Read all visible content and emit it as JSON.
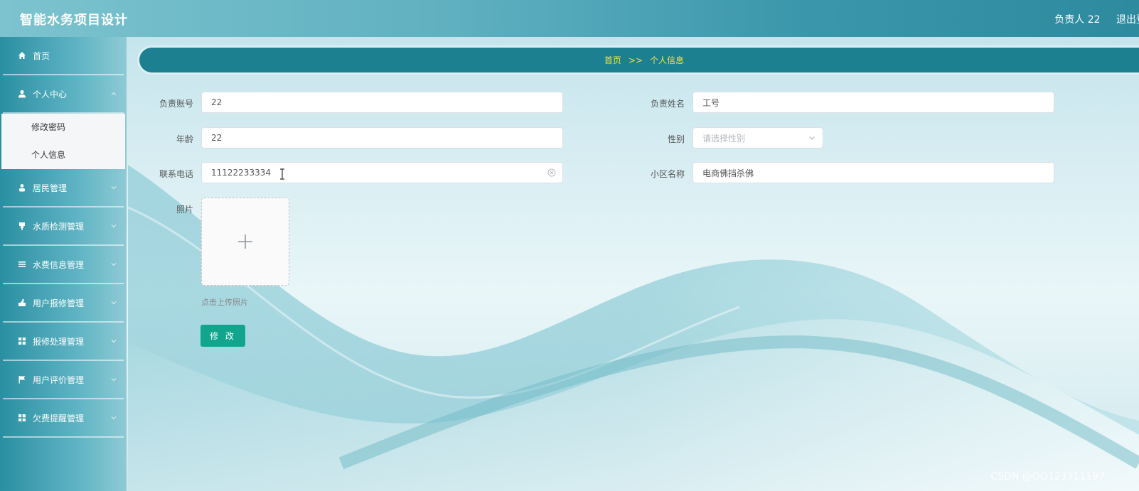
{
  "app": {
    "title": "智能水务项目设计",
    "user_label": "负责人 22",
    "logout_label": "退出登录"
  },
  "sidebar": {
    "items": [
      {
        "label": "首页",
        "icon": "home-icon"
      },
      {
        "label": "个人中心",
        "icon": "user-icon",
        "expanded": true,
        "children": [
          {
            "label": "修改密码"
          },
          {
            "label": "个人信息"
          }
        ]
      },
      {
        "label": "居民管理",
        "icon": "person-icon"
      },
      {
        "label": "水质检测管理",
        "icon": "flask-icon"
      },
      {
        "label": "水费信息管理",
        "icon": "list-icon"
      },
      {
        "label": "用户报修管理",
        "icon": "wrench-icon"
      },
      {
        "label": "报修处理管理",
        "icon": "grid-icon"
      },
      {
        "label": "用户评价管理",
        "icon": "flag-icon"
      },
      {
        "label": "欠费提醒管理",
        "icon": "grid-icon"
      }
    ]
  },
  "breadcrumb": {
    "home": "首页",
    "separator": ">>",
    "current": "个人信息"
  },
  "form": {
    "account_label": "负责账号",
    "account_value": "22",
    "name_label": "负责姓名",
    "name_value": "工号",
    "age_label": "年龄",
    "age_value": "22",
    "gender_label": "性别",
    "gender_placeholder": "请选择性别",
    "phone_label": "联系电话",
    "phone_value": "11122233334",
    "community_label": "小区名称",
    "community_value": "电商佛挡杀佛",
    "photo_label": "照片",
    "upload_hint": "点击上传照片",
    "submit_label": "修 改"
  },
  "watermark": "CSDN @QQ123311197",
  "colors": {
    "header": "#3b97ab",
    "breadcrumb_bar": "#1c8090",
    "breadcrumb_text": "#f5e24a",
    "submit_button": "#12a58e"
  }
}
